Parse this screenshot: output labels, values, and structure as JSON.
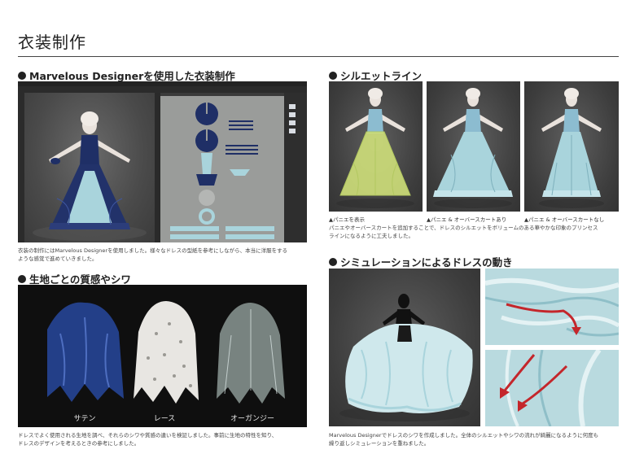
{
  "page": {
    "title": "衣装制作"
  },
  "sections": {
    "marvelous": {
      "heading": "Marvelous Designerを使用した衣装制作",
      "caption_line1": "衣装の制作にはMarvelous Designerを使用しました。様々なドレスの型紙を参考にしながら、本当に洋服をする",
      "caption_line2": "ような感覚で進めていきました。"
    },
    "silhouette": {
      "heading": "シルエットライン",
      "labels": [
        "▲パニエを表示",
        "▲パニエ & オーバースカートあり",
        "▲パニエ & オーバースカートなし"
      ],
      "caption_line1": "パニエやオーバースカートを追加することで、ドレスのシルエットをボリュームのある華やかな印象のプリンセス",
      "caption_line2": "ラインになるように工夫しました。"
    },
    "fabric": {
      "heading": "生地ごとの質感やシワ",
      "labels": [
        "サテン",
        "レース",
        "オーガンジー"
      ],
      "caption_line1": "ドレスでよく使用される生地を調べ、それらのシワや質感の違いを検証しました。事前に生地の特性を知り、",
      "caption_line2": "ドレスのデザインを考えるときの参考にしました。"
    },
    "simulation": {
      "heading": "シミュレーションによるドレスの動き",
      "caption_line1": "Marvelous Designerでドレスのシワを作成しました。全体のシルエットやシワの流れが綺麗になるように何度も",
      "caption_line2": "繰り返しシミュレーションを重ねました。"
    }
  },
  "colors": {
    "dress_navy": "#1f2f66",
    "dress_lightblue": "#a9d4dc",
    "pannier_yellow": "#cfe07a",
    "arrow_red": "#c4262b",
    "skin": "#e9e2dc"
  }
}
